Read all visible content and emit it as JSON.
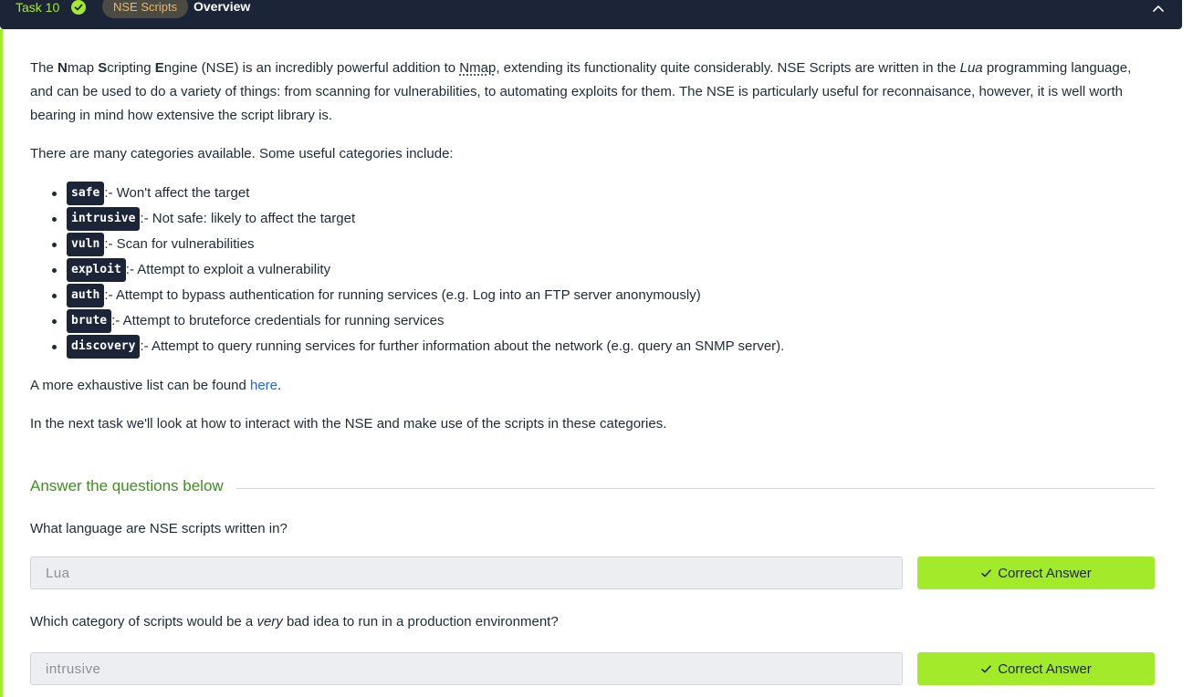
{
  "header": {
    "task_label": "Task 10",
    "tag": "NSE Scripts",
    "title": "Overview"
  },
  "intro": {
    "p1_a": "The ",
    "n_bold": "N",
    "p1_b": "map ",
    "s_bold": "S",
    "p1_c": "cripting ",
    "e_bold": "E",
    "p1_d": "ngine (NSE) is an incredibly powerful addition to ",
    "nmap_abbr": "Nmap",
    "p1_e": ", extending its functionality quite considerably. NSE Scripts are written in the ",
    "lua_italic": "Lua",
    "p1_f": " programming language, and can be used to do a variety of things: from scanning for vulnerabilities, to automating exploits for them. The NSE is particularly useful for reconnaisance, however, it is well worth bearing in mind how extensive the script library is.",
    "p2": "There are many categories available. Some useful categories include:"
  },
  "categories": [
    {
      "name": "safe",
      "desc": ":- Won't affect the target"
    },
    {
      "name": "intrusive",
      "desc": ":- Not safe: likely to affect the target"
    },
    {
      "name": "vuln",
      "desc": ":- Scan for vulnerabilities"
    },
    {
      "name": "exploit",
      "desc": ":- Attempt to exploit a vulnerability"
    },
    {
      "name": "auth",
      "desc": ":- Attempt to bypass authentication for running services (e.g. Log into an FTP server anonymously)"
    },
    {
      "name": "brute",
      "desc": ":- Attempt to bruteforce credentials for running services"
    },
    {
      "name": "discovery",
      "desc": ":- Attempt to query running services for further information about the network (e.g. query an SNMP server)."
    }
  ],
  "more": {
    "prefix": "A more exhaustive list can be found ",
    "link": "here",
    "suffix": "."
  },
  "next_task": "In the next task we'll look at how to interact with the NSE and make use of the scripts in these categories.",
  "answers_heading": "Answer the questions below",
  "questions": [
    {
      "q": "What language are NSE scripts written in?",
      "answer": "Lua",
      "button": "Correct Answer"
    },
    {
      "q_a": "Which category of scripts would be a ",
      "q_em": "very",
      "q_b": " bad idea to run in a production environment?",
      "answer": "intrusive",
      "button": "Correct Answer"
    }
  ],
  "colors": {
    "header_bg": "#1c2538",
    "accent_green": "#a3ea2a",
    "heading_green": "#3f8f1f",
    "link_blue": "#2563eb",
    "tag_bg": "#4b4a43",
    "tag_text": "#f0b65c"
  },
  "icons": {
    "completed": "check-circle-icon",
    "collapse": "chevron-up-icon",
    "button": "check-icon"
  }
}
